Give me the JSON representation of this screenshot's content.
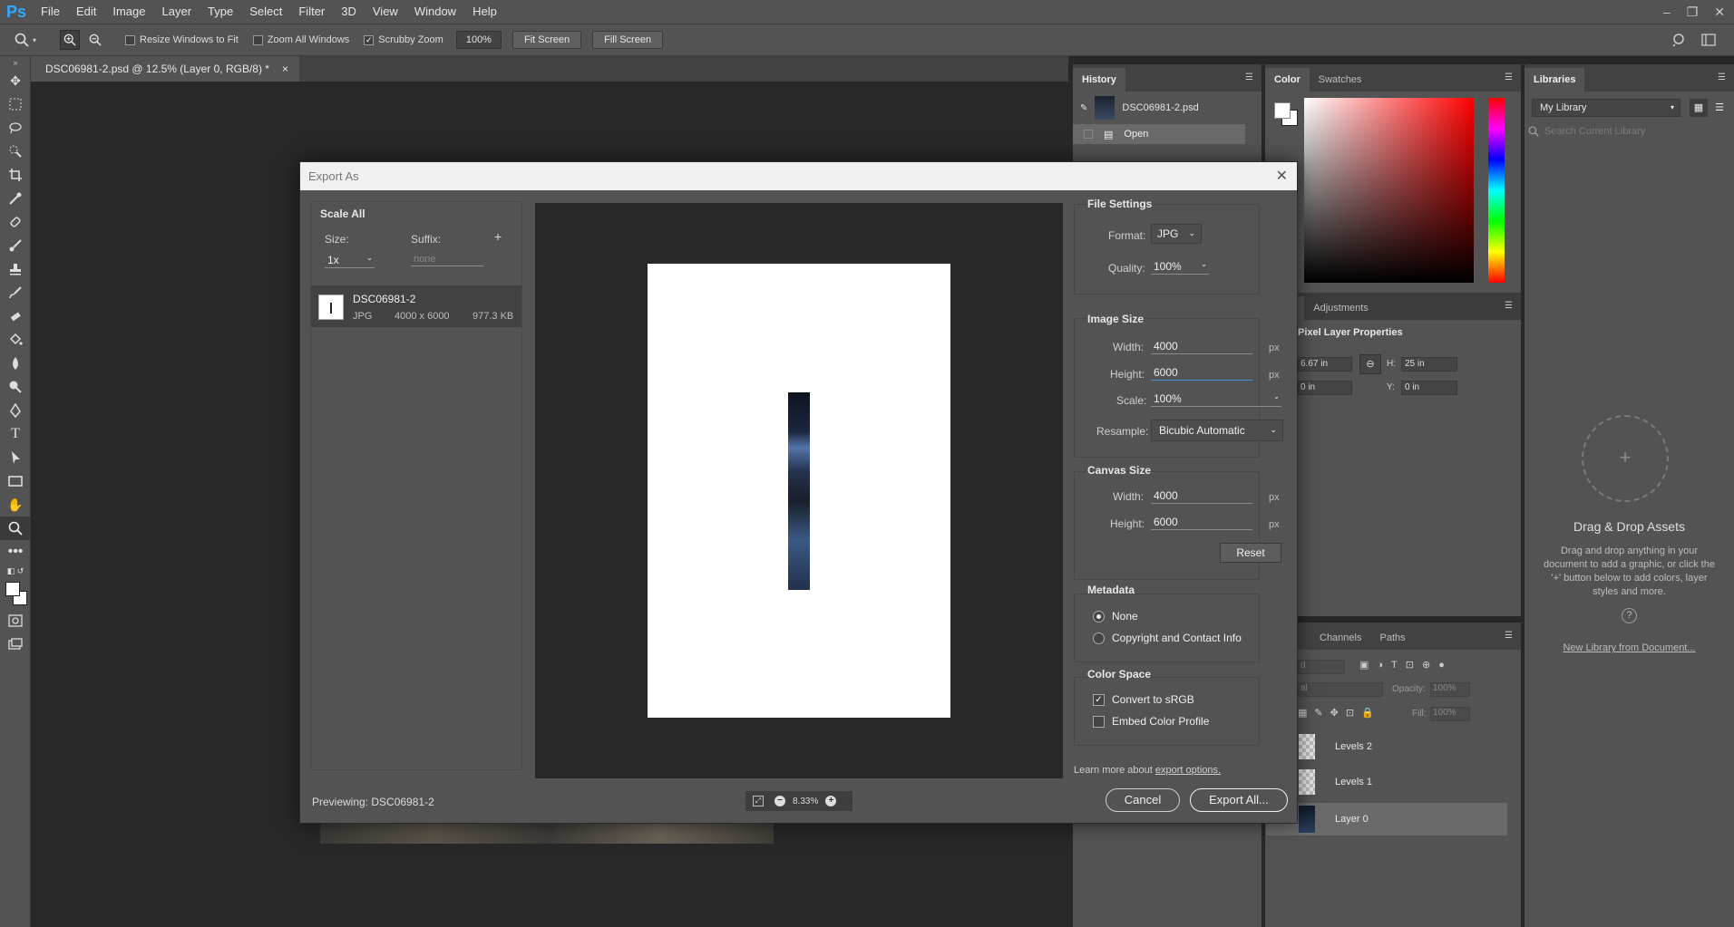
{
  "app": {
    "logo": "Ps",
    "menu": [
      "File",
      "Edit",
      "Image",
      "Layer",
      "Type",
      "Select",
      "Filter",
      "3D",
      "View",
      "Window",
      "Help"
    ],
    "window_controls": [
      "–",
      "❐",
      "✕"
    ]
  },
  "options_bar": {
    "resize_windows": "Resize Windows to Fit",
    "zoom_all": "Zoom All Windows",
    "scrubby_zoom": "Scrubby Zoom",
    "zoom_value": "100%",
    "fit_screen": "Fit Screen",
    "fill_screen": "Fill Screen"
  },
  "document_tab": {
    "title": "DSC06981-2.psd @ 12.5% (Layer 0, RGB/8) *",
    "close": "×"
  },
  "history_panel": {
    "tab": "History",
    "snapshot": "DSC06981-2.psd",
    "step": "Open"
  },
  "color_panel": {
    "tabs": [
      "Color",
      "Swatches"
    ]
  },
  "libraries_panel": {
    "tab": "Libraries",
    "library": "My Library",
    "search_placeholder": "Search Current Library",
    "drag_title": "Drag & Drop Assets",
    "drag_text": "Drag and drop anything in your document to add a graphic, or click the '+' button below to add colors, layer styles and more.",
    "help": "?",
    "new_library_link": "New Library from Document..."
  },
  "properties_panel": {
    "tabs": [
      "rties",
      "Adjustments"
    ],
    "title": "Pixel Layer Properties",
    "w_value": "6.67 in",
    "h_label": "H:",
    "h_value": "25 in",
    "x_value": "0 in",
    "y_label": "Y:",
    "y_value": "0 in"
  },
  "layers_panel": {
    "tabs": [
      "Channels",
      "Paths"
    ],
    "kind": "d",
    "blend": "al",
    "opacity_label": "Opacity:",
    "opacity_value": "100%",
    "fill_label": "Fill:",
    "fill_value": "100%",
    "layers": [
      "Levels 2",
      "Levels 1",
      "Layer 0"
    ]
  },
  "export_dialog": {
    "title": "Export As",
    "close": "✕",
    "scale_all": "Scale All",
    "size_label": "Size:",
    "suffix_label": "Suffix:",
    "add": "+",
    "size_value": "1x",
    "suffix_placeholder": "none",
    "asset": {
      "name": "DSC06981-2",
      "format": "JPG",
      "dimensions": "4000 x 6000",
      "filesize": "977.3 KB"
    },
    "previewing": "Previewing: DSC06981-2",
    "zoom_minus": "−",
    "zoom_value": "8.33%",
    "zoom_plus": "+",
    "file_settings": {
      "title": "File Settings",
      "format_label": "Format:",
      "format_value": "JPG",
      "quality_label": "Quality:",
      "quality_value": "100%"
    },
    "image_size": {
      "title": "Image Size",
      "width_label": "Width:",
      "width_value": "4000",
      "height_label": "Height:",
      "height_value": "6000",
      "scale_label": "Scale:",
      "scale_value": "100%",
      "resample_label": "Resample:",
      "resample_value": "Bicubic Automatic",
      "unit": "px"
    },
    "canvas_size": {
      "title": "Canvas Size",
      "width_label": "Width:",
      "width_value": "4000",
      "height_label": "Height:",
      "height_value": "6000",
      "unit": "px",
      "reset": "Reset"
    },
    "metadata": {
      "title": "Metadata",
      "none": "None",
      "copyright": "Copyright and Contact Info"
    },
    "color_space": {
      "title": "Color Space",
      "convert": "Convert to sRGB",
      "embed": "Embed Color Profile"
    },
    "learn_more_prefix": "Learn more about",
    "learn_more_link": "export options.",
    "cancel": "Cancel",
    "export_all": "Export All..."
  }
}
